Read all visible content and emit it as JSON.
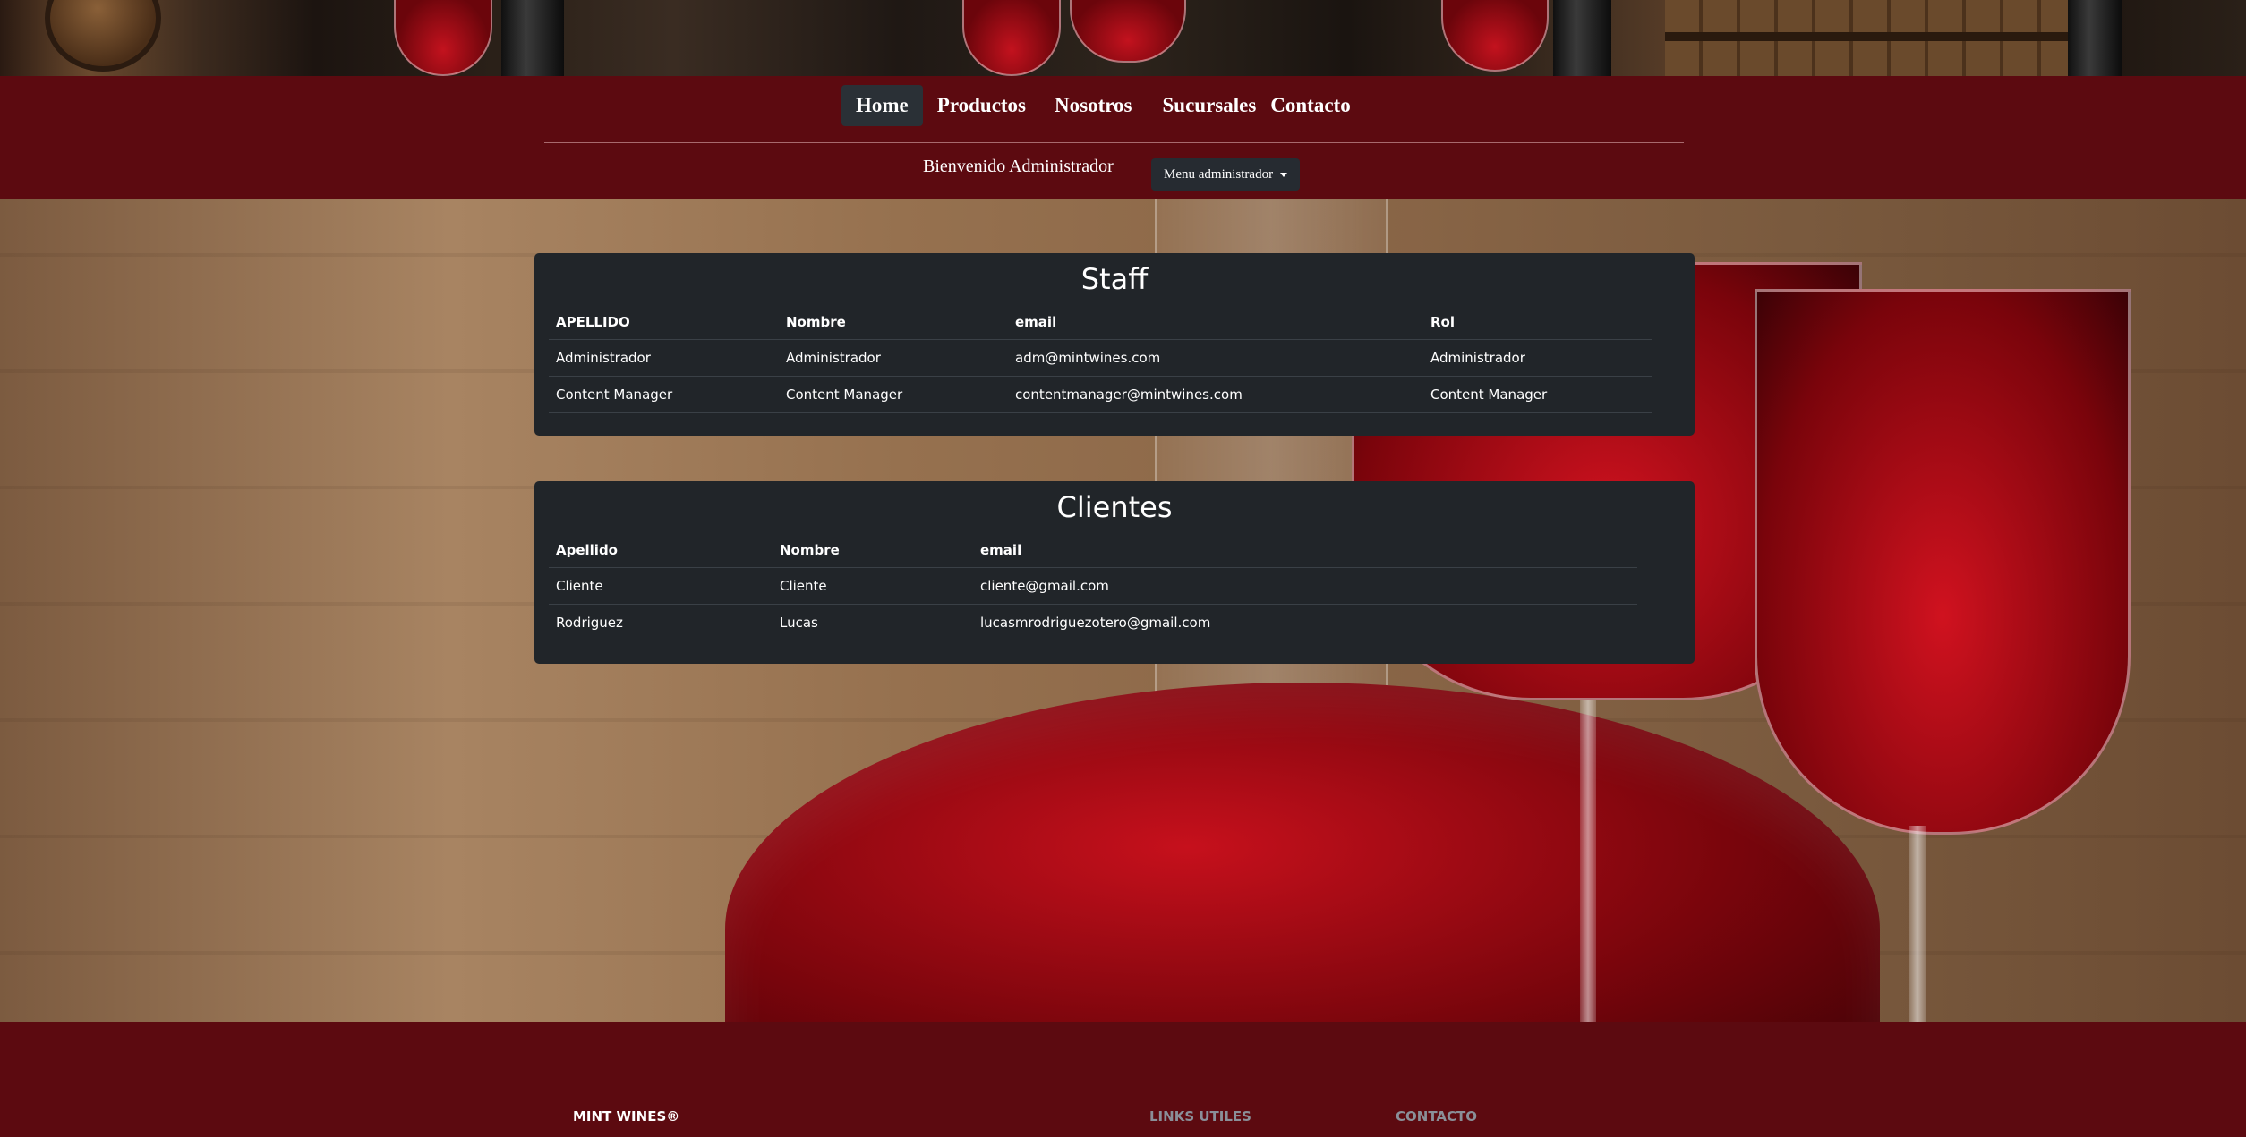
{
  "nav": {
    "items": [
      {
        "label": "Home",
        "active": true
      },
      {
        "label": "Productos",
        "active": false
      },
      {
        "label": "Nosotros",
        "active": false
      },
      {
        "label": "Sucursales",
        "active": false
      },
      {
        "label": "Contacto",
        "active": false
      }
    ],
    "welcome": "Bienvenido Administrador",
    "admin_menu_label": "Menu administrador"
  },
  "staff": {
    "title": "Staff",
    "columns": [
      "APELLIDO",
      "Nombre",
      "email",
      "Rol"
    ],
    "rows": [
      [
        "Administrador",
        "Administrador",
        "adm@mintwines.com",
        "Administrador"
      ],
      [
        "Content Manager",
        "Content Manager",
        "contentmanager@mintwines.com",
        "Content Manager"
      ]
    ]
  },
  "clientes": {
    "title": "Clientes",
    "columns": [
      "Apellido",
      "Nombre",
      "email"
    ],
    "rows": [
      [
        "Cliente",
        "Cliente",
        "cliente@gmail.com"
      ],
      [
        "Rodriguez",
        "Lucas",
        "lucasmrodriguezotero@gmail.com"
      ]
    ]
  },
  "footer": {
    "brand": "MINT WINES®",
    "links_heading": "LINKS UTILES",
    "contact_heading": "CONTACTO"
  },
  "colors": {
    "header_bg": "#5c0a10",
    "card_bg": "#212529",
    "active_nav_bg": "#2a3036"
  }
}
